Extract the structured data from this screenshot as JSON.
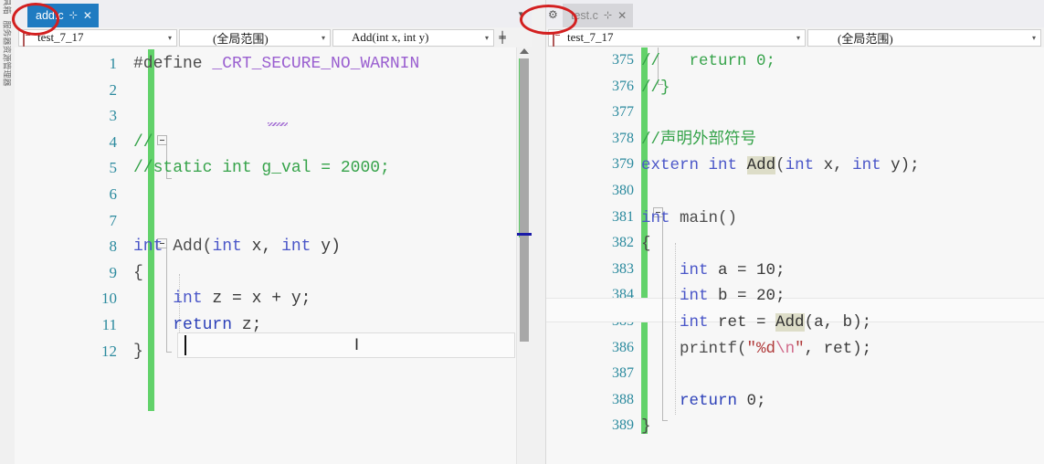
{
  "window": {
    "background": "#f0f0f0",
    "accent_blue": "#1f7bc1",
    "annotation_color": "#d32020"
  },
  "vertical_toolstrip": {
    "items": [
      {
        "label": "工具箱",
        "name": "toolbox"
      },
      {
        "label": "服务器资源管理器",
        "name": "server-explorer"
      }
    ]
  },
  "left_pane": {
    "tab": {
      "title": "add.c",
      "pin_glyph": "⊹",
      "close_glyph": "✕",
      "state": "active",
      "highlighted": true
    },
    "tabstrip_icons": {
      "dropdown_glyph": "▾",
      "settings_glyph": "⚙"
    },
    "navbar": {
      "project_dropdown": {
        "value": "test_7_17",
        "arrow": "▾",
        "icon": "project-icon"
      },
      "scope_dropdown": {
        "value": "(全局范围)",
        "arrow": "▾"
      },
      "member_dropdown": {
        "value": "Add(int x, int y)",
        "arrow": "▾",
        "icon": "method-icon"
      },
      "split_button_glyph": "╪"
    },
    "editor": {
      "line_numbers": [
        "1",
        "2",
        "3",
        "4",
        "5",
        "6",
        "7",
        "8",
        "9",
        "10",
        "11",
        "12"
      ],
      "lines": [
        {
          "n": "1",
          "tokens": [
            {
              "t": "#define ",
              "c": "fn"
            },
            {
              "t": "_CRT_SECURE_NO_WARNIN",
              "c": "macro"
            }
          ]
        },
        {
          "n": "2",
          "tokens": []
        },
        {
          "n": "3",
          "tokens": []
        },
        {
          "n": "4",
          "tokens": [
            {
              "t": "//",
              "c": "cmt"
            }
          ]
        },
        {
          "n": "5",
          "tokens": [
            {
              "t": "//static int g_val = 2000;",
              "c": "cmt"
            }
          ]
        },
        {
          "n": "6",
          "tokens": []
        },
        {
          "n": "7",
          "tokens": []
        },
        {
          "n": "8",
          "tokens": [
            {
              "t": "int",
              "c": "kw"
            },
            {
              "t": " ",
              "c": "id"
            },
            {
              "t": "Add",
              "c": "fn"
            },
            {
              "t": "(",
              "c": "punct"
            },
            {
              "t": "int",
              "c": "kw"
            },
            {
              "t": " x, ",
              "c": "id"
            },
            {
              "t": "int",
              "c": "kw"
            },
            {
              "t": " y)",
              "c": "id"
            }
          ]
        },
        {
          "n": "9",
          "tokens": [
            {
              "t": "{",
              "c": "punct"
            }
          ]
        },
        {
          "n": "10",
          "tokens": [
            {
              "t": "    ",
              "c": "id"
            },
            {
              "t": "int",
              "c": "kw"
            },
            {
              "t": " z = x + y;",
              "c": "id"
            }
          ]
        },
        {
          "n": "11",
          "tokens": [
            {
              "t": "    ",
              "c": "id"
            },
            {
              "t": "return",
              "c": "kw2"
            },
            {
              "t": " z;",
              "c": "id"
            }
          ]
        },
        {
          "n": "12",
          "tokens": [
            {
              "t": "}",
              "c": "punct"
            }
          ]
        }
      ]
    },
    "scrollbar": {
      "up_arrow": "▲",
      "change_marker_color": "#62d26a",
      "caret_marker_color": "#1a1aa8"
    }
  },
  "right_pane": {
    "tab": {
      "title": "test.c",
      "pin_glyph": "⊹",
      "close_glyph": "✕",
      "state": "inactive",
      "highlighted": true
    },
    "tabstrip_icons": {
      "dropdown_glyph": "▾",
      "settings_glyph": "⚙"
    },
    "navbar": {
      "project_dropdown": {
        "value": "test_7_17",
        "arrow": "▾",
        "icon": "project-icon"
      },
      "scope_dropdown": {
        "value": "(全局范围)",
        "arrow": "▾"
      }
    },
    "editor": {
      "line_numbers": [
        "375",
        "376",
        "377",
        "378",
        "379",
        "380",
        "381",
        "382",
        "383",
        "384",
        "385",
        "386",
        "387",
        "388",
        "389"
      ],
      "current_line": "385",
      "lines": [
        {
          "n": "375",
          "tokens": [
            {
              "t": "//   return 0;",
              "c": "cmt"
            }
          ]
        },
        {
          "n": "376",
          "tokens": [
            {
              "t": "//}",
              "c": "cmt"
            }
          ]
        },
        {
          "n": "377",
          "tokens": []
        },
        {
          "n": "378",
          "tokens": [
            {
              "t": "//声明外部符号",
              "c": "cmt"
            }
          ]
        },
        {
          "n": "379",
          "tokens": [
            {
              "t": "extern",
              "c": "kw"
            },
            {
              "t": " ",
              "c": "id"
            },
            {
              "t": "int",
              "c": "kw"
            },
            {
              "t": " ",
              "c": "id"
            },
            {
              "t": "Add",
              "c": "hl"
            },
            {
              "t": "(",
              "c": "punct"
            },
            {
              "t": "int",
              "c": "kw"
            },
            {
              "t": " x, ",
              "c": "id"
            },
            {
              "t": "int",
              "c": "kw"
            },
            {
              "t": " y);",
              "c": "id"
            }
          ]
        },
        {
          "n": "380",
          "tokens": []
        },
        {
          "n": "381",
          "tokens": [
            {
              "t": "int",
              "c": "kw"
            },
            {
              "t": " ",
              "c": "id"
            },
            {
              "t": "main",
              "c": "fn"
            },
            {
              "t": "()",
              "c": "punct"
            }
          ]
        },
        {
          "n": "382",
          "tokens": [
            {
              "t": "{",
              "c": "punct"
            }
          ]
        },
        {
          "n": "383",
          "tokens": [
            {
              "t": "    ",
              "c": "id"
            },
            {
              "t": "int",
              "c": "kw"
            },
            {
              "t": " a = ",
              "c": "id"
            },
            {
              "t": "10",
              "c": "id"
            },
            {
              "t": ";",
              "c": "id"
            }
          ]
        },
        {
          "n": "384",
          "tokens": [
            {
              "t": "    ",
              "c": "id"
            },
            {
              "t": "int",
              "c": "kw"
            },
            {
              "t": " b = ",
              "c": "id"
            },
            {
              "t": "20",
              "c": "id"
            },
            {
              "t": ";",
              "c": "id"
            }
          ]
        },
        {
          "n": "385",
          "tokens": [
            {
              "t": "    ",
              "c": "id"
            },
            {
              "t": "int",
              "c": "kw"
            },
            {
              "t": " ret = ",
              "c": "id"
            },
            {
              "t": "Add",
              "c": "hl"
            },
            {
              "t": "(a, b);",
              "c": "id"
            }
          ]
        },
        {
          "n": "386",
          "tokens": [
            {
              "t": "    ",
              "c": "id"
            },
            {
              "t": "printf",
              "c": "fn"
            },
            {
              "t": "(",
              "c": "punct"
            },
            {
              "t": "\"%d",
              "c": "str"
            },
            {
              "t": "\\n",
              "c": "esc"
            },
            {
              "t": "\"",
              "c": "str"
            },
            {
              "t": ", ret);",
              "c": "id"
            }
          ]
        },
        {
          "n": "387",
          "tokens": []
        },
        {
          "n": "388",
          "tokens": [
            {
              "t": "    ",
              "c": "id"
            },
            {
              "t": "return",
              "c": "kw2"
            },
            {
              "t": " ",
              "c": "id"
            },
            {
              "t": "0",
              "c": "id"
            },
            {
              "t": ";",
              "c": "id"
            }
          ]
        },
        {
          "n": "389",
          "tokens": [
            {
              "t": "}",
              "c": "punct"
            }
          ]
        }
      ]
    }
  },
  "annotations": [
    {
      "name": "circle-around-add-c-tab",
      "shape": "ellipse"
    },
    {
      "name": "circle-around-test-c-tab",
      "shape": "ellipse"
    }
  ]
}
